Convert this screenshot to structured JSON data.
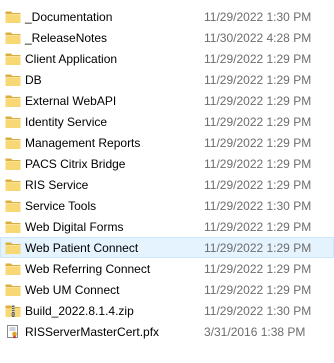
{
  "files": [
    {
      "name": "_Documentation",
      "modified": "11/29/2022 1:30 PM",
      "icon": "folder-icon"
    },
    {
      "name": "_ReleaseNotes",
      "modified": "11/30/2022 4:28 PM",
      "icon": "folder-icon"
    },
    {
      "name": "Client Application",
      "modified": "11/29/2022 1:29 PM",
      "icon": "folder-icon"
    },
    {
      "name": "DB",
      "modified": "11/29/2022 1:29 PM",
      "icon": "folder-icon"
    },
    {
      "name": "External WebAPI",
      "modified": "11/29/2022 1:29 PM",
      "icon": "folder-icon"
    },
    {
      "name": "Identity Service",
      "modified": "11/29/2022 1:29 PM",
      "icon": "folder-icon"
    },
    {
      "name": "Management Reports",
      "modified": "11/29/2022 1:29 PM",
      "icon": "folder-icon"
    },
    {
      "name": "PACS Citrix Bridge",
      "modified": "11/29/2022 1:29 PM",
      "icon": "folder-icon"
    },
    {
      "name": "RIS Service",
      "modified": "11/29/2022 1:29 PM",
      "icon": "folder-icon"
    },
    {
      "name": "Service Tools",
      "modified": "11/29/2022 1:30 PM",
      "icon": "folder-icon"
    },
    {
      "name": "Web Digital Forms",
      "modified": "11/29/2022 1:29 PM",
      "icon": "folder-icon"
    },
    {
      "name": "Web Patient Connect",
      "modified": "11/29/2022 1:29 PM",
      "icon": "folder-icon",
      "hovered": true
    },
    {
      "name": "Web Referring Connect",
      "modified": "11/29/2022 1:29 PM",
      "icon": "folder-icon"
    },
    {
      "name": "Web UM Connect",
      "modified": "11/29/2022 1:29 PM",
      "icon": "folder-icon"
    },
    {
      "name": "Build_2022.8.1.4.zip",
      "modified": "11/29/2022 1:30 PM",
      "icon": "zip-folder-icon"
    },
    {
      "name": "RISServerMasterCert.pfx",
      "modified": "3/31/2016 1:38 PM",
      "icon": "certificate-icon"
    }
  ],
  "colors": {
    "folder_back": "#dcae3f",
    "folder_front": "#f8d775",
    "hover_bg": "#e5f3ff",
    "hover_border": "#cce8ff",
    "date_text": "#6d6d6d"
  }
}
